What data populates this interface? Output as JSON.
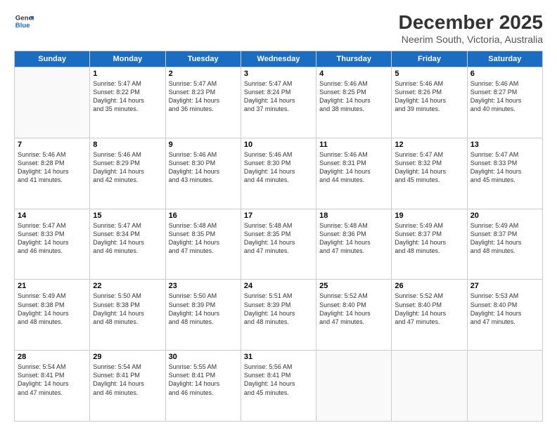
{
  "logo": {
    "line1": "General",
    "line2": "Blue"
  },
  "title": "December 2025",
  "subtitle": "Neerim South, Victoria, Australia",
  "days_header": [
    "Sunday",
    "Monday",
    "Tuesday",
    "Wednesday",
    "Thursday",
    "Friday",
    "Saturday"
  ],
  "weeks": [
    [
      {
        "day": "",
        "info": ""
      },
      {
        "day": "1",
        "info": "Sunrise: 5:47 AM\nSunset: 8:22 PM\nDaylight: 14 hours\nand 35 minutes."
      },
      {
        "day": "2",
        "info": "Sunrise: 5:47 AM\nSunset: 8:23 PM\nDaylight: 14 hours\nand 36 minutes."
      },
      {
        "day": "3",
        "info": "Sunrise: 5:47 AM\nSunset: 8:24 PM\nDaylight: 14 hours\nand 37 minutes."
      },
      {
        "day": "4",
        "info": "Sunrise: 5:46 AM\nSunset: 8:25 PM\nDaylight: 14 hours\nand 38 minutes."
      },
      {
        "day": "5",
        "info": "Sunrise: 5:46 AM\nSunset: 8:26 PM\nDaylight: 14 hours\nand 39 minutes."
      },
      {
        "day": "6",
        "info": "Sunrise: 5:46 AM\nSunset: 8:27 PM\nDaylight: 14 hours\nand 40 minutes."
      }
    ],
    [
      {
        "day": "7",
        "info": "Sunrise: 5:46 AM\nSunset: 8:28 PM\nDaylight: 14 hours\nand 41 minutes."
      },
      {
        "day": "8",
        "info": "Sunrise: 5:46 AM\nSunset: 8:29 PM\nDaylight: 14 hours\nand 42 minutes."
      },
      {
        "day": "9",
        "info": "Sunrise: 5:46 AM\nSunset: 8:30 PM\nDaylight: 14 hours\nand 43 minutes."
      },
      {
        "day": "10",
        "info": "Sunrise: 5:46 AM\nSunset: 8:30 PM\nDaylight: 14 hours\nand 44 minutes."
      },
      {
        "day": "11",
        "info": "Sunrise: 5:46 AM\nSunset: 8:31 PM\nDaylight: 14 hours\nand 44 minutes."
      },
      {
        "day": "12",
        "info": "Sunrise: 5:47 AM\nSunset: 8:32 PM\nDaylight: 14 hours\nand 45 minutes."
      },
      {
        "day": "13",
        "info": "Sunrise: 5:47 AM\nSunset: 8:33 PM\nDaylight: 14 hours\nand 45 minutes."
      }
    ],
    [
      {
        "day": "14",
        "info": "Sunrise: 5:47 AM\nSunset: 8:33 PM\nDaylight: 14 hours\nand 46 minutes."
      },
      {
        "day": "15",
        "info": "Sunrise: 5:47 AM\nSunset: 8:34 PM\nDaylight: 14 hours\nand 46 minutes."
      },
      {
        "day": "16",
        "info": "Sunrise: 5:48 AM\nSunset: 8:35 PM\nDaylight: 14 hours\nand 47 minutes."
      },
      {
        "day": "17",
        "info": "Sunrise: 5:48 AM\nSunset: 8:35 PM\nDaylight: 14 hours\nand 47 minutes."
      },
      {
        "day": "18",
        "info": "Sunrise: 5:48 AM\nSunset: 8:36 PM\nDaylight: 14 hours\nand 47 minutes."
      },
      {
        "day": "19",
        "info": "Sunrise: 5:49 AM\nSunset: 8:37 PM\nDaylight: 14 hours\nand 48 minutes."
      },
      {
        "day": "20",
        "info": "Sunrise: 5:49 AM\nSunset: 8:37 PM\nDaylight: 14 hours\nand 48 minutes."
      }
    ],
    [
      {
        "day": "21",
        "info": "Sunrise: 5:49 AM\nSunset: 8:38 PM\nDaylight: 14 hours\nand 48 minutes."
      },
      {
        "day": "22",
        "info": "Sunrise: 5:50 AM\nSunset: 8:38 PM\nDaylight: 14 hours\nand 48 minutes."
      },
      {
        "day": "23",
        "info": "Sunrise: 5:50 AM\nSunset: 8:39 PM\nDaylight: 14 hours\nand 48 minutes."
      },
      {
        "day": "24",
        "info": "Sunrise: 5:51 AM\nSunset: 8:39 PM\nDaylight: 14 hours\nand 48 minutes."
      },
      {
        "day": "25",
        "info": "Sunrise: 5:52 AM\nSunset: 8:40 PM\nDaylight: 14 hours\nand 47 minutes."
      },
      {
        "day": "26",
        "info": "Sunrise: 5:52 AM\nSunset: 8:40 PM\nDaylight: 14 hours\nand 47 minutes."
      },
      {
        "day": "27",
        "info": "Sunrise: 5:53 AM\nSunset: 8:40 PM\nDaylight: 14 hours\nand 47 minutes."
      }
    ],
    [
      {
        "day": "28",
        "info": "Sunrise: 5:54 AM\nSunset: 8:41 PM\nDaylight: 14 hours\nand 47 minutes."
      },
      {
        "day": "29",
        "info": "Sunrise: 5:54 AM\nSunset: 8:41 PM\nDaylight: 14 hours\nand 46 minutes."
      },
      {
        "day": "30",
        "info": "Sunrise: 5:55 AM\nSunset: 8:41 PM\nDaylight: 14 hours\nand 46 minutes."
      },
      {
        "day": "31",
        "info": "Sunrise: 5:56 AM\nSunset: 8:41 PM\nDaylight: 14 hours\nand 45 minutes."
      },
      {
        "day": "",
        "info": ""
      },
      {
        "day": "",
        "info": ""
      },
      {
        "day": "",
        "info": ""
      }
    ]
  ]
}
